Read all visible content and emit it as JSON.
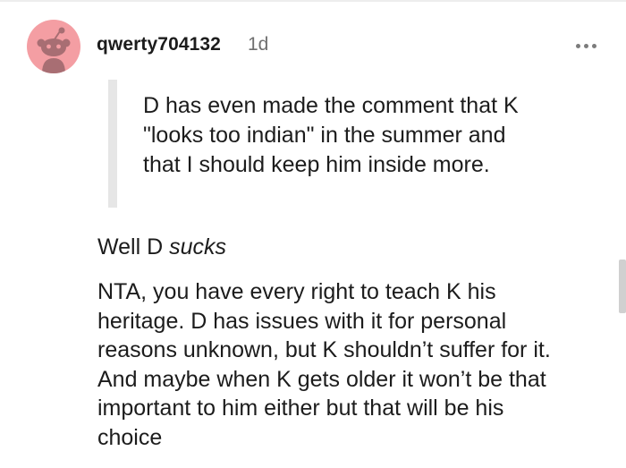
{
  "comment": {
    "author": "qwerty704132",
    "timestamp": "1d",
    "avatar_icon": "reddit-snoo-icon",
    "avatar_color": "#f49ea3",
    "more_icon": "more-options-icon",
    "quote_lines": [
      "D has even made the comment that K",
      "\"looks too indian\" in the summer and",
      "that I should keep him inside more."
    ],
    "para1_prefix": "Well D ",
    "para1_emphasis": "sucks",
    "para2_lines": [
      "NTA, you have every right to teach K his",
      "heritage. D has issues with it for personal",
      "reasons unknown, but K shouldn’t suffer for it.",
      "And maybe when K gets older it won’t be that",
      "important to him either but that will be his",
      "choice"
    ]
  }
}
